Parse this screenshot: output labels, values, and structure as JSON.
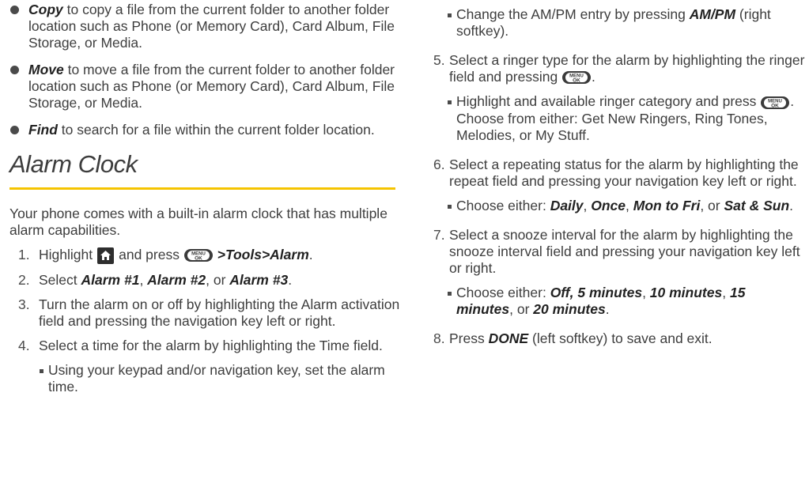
{
  "left": {
    "bullets": [
      {
        "term": "Copy",
        "text": " to copy a file from the current folder to another folder location such as Phone (or Memory Card), Card Album, File Storage, or Media."
      },
      {
        "term": "Move",
        "text": " to move a file from the current folder to another folder location such as Phone  (or Memory Card), Card Album, File Storage, or Media."
      },
      {
        "term": "Find",
        "text": " to search for a file within the current folder location."
      }
    ],
    "heading": "Alarm Clock",
    "intro": "Your phone comes with a built-in alarm clock that has multiple alarm capabilities.",
    "step1": {
      "num": "1.",
      "a": "Highlight",
      "b": "and press",
      "c": ">Tools>Alarm",
      "d": "."
    },
    "step2": {
      "num": "2.",
      "a": "Select ",
      "t1": "Alarm #1",
      "s1": ", ",
      "t2": "Alarm #2",
      "s2": ", or ",
      "t3": "Alarm #3",
      "e": "."
    },
    "step3": {
      "num": "3.",
      "text": "Turn the alarm on or off by highlighting the Alarm activation field and pressing the navigation key left or right."
    },
    "step4": {
      "num": "4.",
      "text": "Select a time for the alarm by highlighting the Time field."
    },
    "step4_sub": "Using your keypad and/or navigation key, set the alarm time."
  },
  "right": {
    "ampm": {
      "a": "Change the AM/PM entry by pressing ",
      "t": "AM/PM",
      "b": " (right softkey)."
    },
    "step5": {
      "num": "5.",
      "text": "Select a ringer type for the alarm by highlighting the ringer field and pressing",
      "end": "."
    },
    "step5_sub": {
      "a": "Highlight and available ringer category and press",
      "b": ". Choose from either: Get New Ringers, Ring Tones, Melodies, or My Stuff."
    },
    "step6": {
      "num": "6.",
      "text": "Select a repeating status for the alarm by highlighting the repeat field and pressing your navigation key left or right."
    },
    "step6_sub": {
      "a": "Choose either: ",
      "t1": "Daily",
      "s1": ", ",
      "t2": "Once",
      "s2": ", ",
      "t3": "Mon to Fri",
      "s3": ", or ",
      "t4": "Sat & Sun",
      "e": "."
    },
    "step7": {
      "num": "7.",
      "text": "Select a snooze interval for the alarm by highlighting the snooze interval field and pressing your navigation key left or right."
    },
    "step7_sub": {
      "a": "Choose either: ",
      "t1": "Off, 5 minutes",
      "s1": ", ",
      "t2": "10 minutes",
      "s2": ", ",
      "t3": "15 minutes",
      "s3": ", or ",
      "t4": "20 minutes",
      "e": "."
    },
    "step8": {
      "num": "8.",
      "a": "Press ",
      "t": "DONE",
      "b": " (left softkey) to save and exit."
    }
  },
  "key_labels": {
    "menu_top": "MENU",
    "menu_bottom": "OK"
  },
  "colors": {
    "rule": "#f5c400",
    "text": "#3d3d3d"
  },
  "icons": [
    "bullet-dot-icon",
    "home-icon",
    "menu-ok-key-icon"
  ]
}
